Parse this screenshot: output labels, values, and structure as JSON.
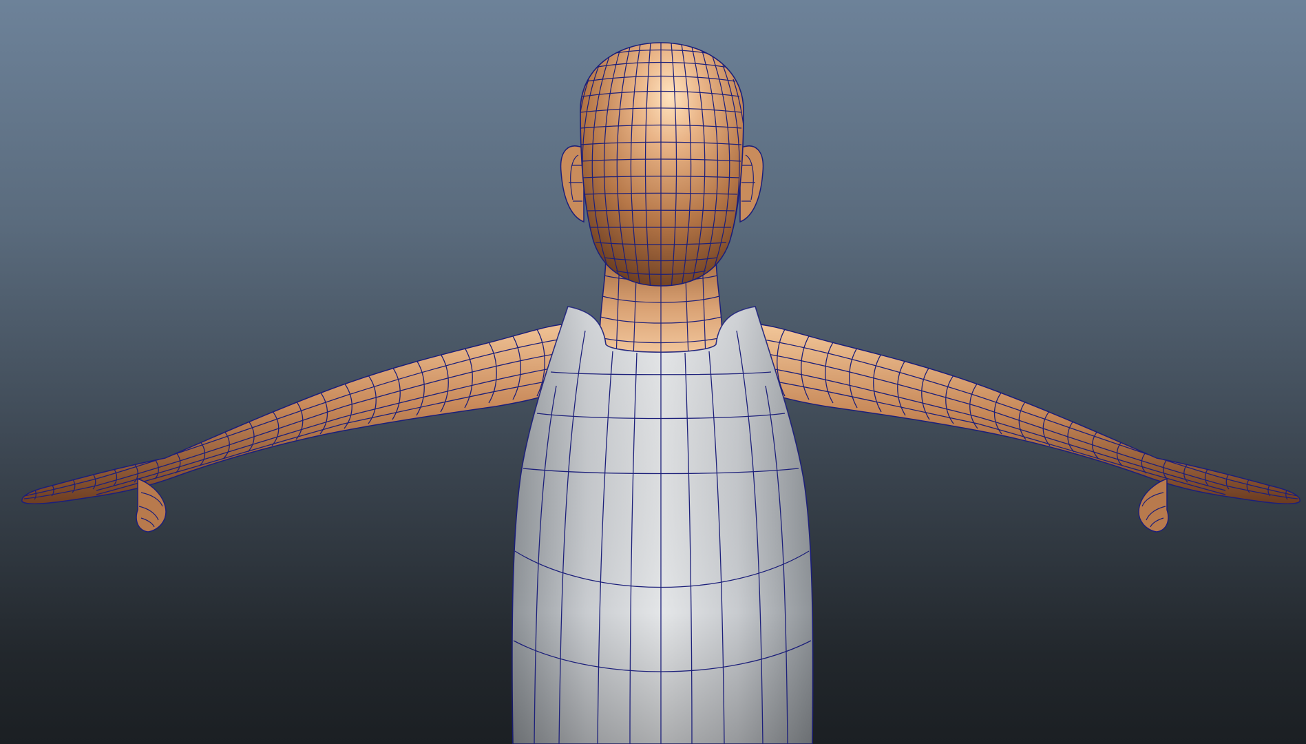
{
  "viewport": {
    "mode": "perspective-3d-viewport",
    "background_gradient": [
      "#6d8299",
      "#5a6b7d",
      "#3b4550",
      "#22272c",
      "#1b1f23"
    ],
    "wireframe_color": "#1c1f7a"
  },
  "model": {
    "type": "character-mesh-t-pose",
    "view": "back",
    "skin_color": "#c88a5e",
    "skin_highlight": "#f2c79c",
    "skin_shadow": "#7a4a2a",
    "shirt_color": "#cfd2d6",
    "shirt_shadow": "#9ea3a8",
    "shirt_highlight": "#eef0f2"
  }
}
